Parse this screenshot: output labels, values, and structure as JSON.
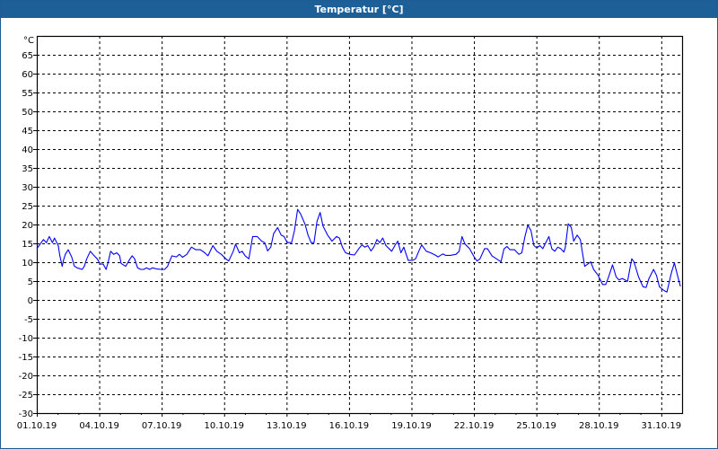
{
  "window": {
    "title": "Temperatur [°C]"
  },
  "chart_data": {
    "type": "line",
    "title": "Temperatur [°C]",
    "ylabel": "°C",
    "xlabel": "",
    "ylim": [
      -30,
      70
    ],
    "yticks": [
      65,
      60,
      55,
      50,
      45,
      40,
      35,
      30,
      25,
      20,
      15,
      10,
      5,
      0,
      -5,
      -10,
      -15,
      -20,
      -25,
      -30
    ],
    "xlim_days": [
      0,
      31
    ],
    "xtick_labels": [
      "01.10.19",
      "04.10.19",
      "07.10.19",
      "10.10.19",
      "13.10.19",
      "16.10.19",
      "19.10.19",
      "22.10.19",
      "25.10.19",
      "28.10.19",
      "31.10.19"
    ],
    "xtick_days": [
      0,
      3,
      6,
      9,
      12,
      15,
      18,
      21,
      24,
      27,
      30
    ],
    "grid": true,
    "series": [
      {
        "name": "Temperatur",
        "color": "#0000ff",
        "x_days": [
          0,
          0.32,
          0.46,
          0.6,
          0.75,
          0.85,
          0.96,
          1.03,
          1.11,
          1.22,
          1.28,
          1.37,
          1.51,
          1.68,
          1.8,
          1.94,
          2.18,
          2.28,
          2.4,
          2.57,
          2.76,
          2.9,
          3.05,
          3.19,
          3.33,
          3.43,
          3.55,
          3.69,
          3.84,
          3.98,
          4.05,
          4.27,
          4.48,
          4.58,
          4.7,
          4.84,
          4.99,
          5.13,
          5.27,
          5.42,
          5.56,
          5.78,
          5.99,
          6.14,
          6.28,
          6.49,
          6.71,
          6.85,
          7.0,
          7.21,
          7.43,
          7.64,
          7.86,
          8.07,
          8.22,
          8.46,
          8.65,
          8.86,
          9.08,
          9.22,
          9.44,
          9.55,
          9.73,
          9.87,
          10.01,
          10.19,
          10.37,
          10.59,
          10.8,
          10.95,
          11.09,
          11.24,
          11.38,
          11.57,
          11.74,
          11.88,
          12.03,
          12.24,
          12.38,
          12.53,
          12.67,
          12.89,
          13.03,
          13.18,
          13.32,
          13.46,
          13.61,
          13.75,
          13.97,
          14.18,
          14.4,
          14.54,
          14.68,
          14.83,
          15.04,
          15.26,
          15.47,
          15.62,
          15.76,
          15.9,
          16.05,
          16.19,
          16.34,
          16.48,
          16.62,
          16.77,
          17.05,
          17.2,
          17.34,
          17.49,
          17.63,
          17.84,
          18.06,
          18.2,
          18.35,
          18.49,
          18.71,
          18.92,
          19.14,
          19.28,
          19.5,
          19.64,
          19.86,
          20.14,
          20.29,
          20.43,
          20.57,
          20.79,
          21.01,
          21.15,
          21.29,
          21.51,
          21.65,
          21.87,
          22.08,
          22.3,
          22.44,
          22.59,
          22.73,
          22.95,
          23.16,
          23.3,
          23.45,
          23.59,
          23.74,
          23.88,
          24.02,
          24.17,
          24.31,
          24.45,
          24.6,
          24.74,
          24.88,
          25.03,
          25.17,
          25.32,
          25.39,
          25.53,
          25.68,
          25.79,
          25.96,
          26.11,
          26.25,
          26.32,
          26.61,
          26.75,
          26.97,
          27.18,
          27.33,
          27.47,
          27.66,
          27.83,
          27.97,
          28.12,
          28.26,
          28.38,
          28.58,
          28.69,
          28.91,
          29.12,
          29.27,
          29.41,
          29.63,
          29.77,
          29.91,
          30.13,
          30.27,
          30.49,
          30.63,
          30.78,
          30.92
        ],
        "values": [
          13.6,
          16.0,
          15.2,
          16.8,
          15.2,
          16.4,
          15.2,
          14.4,
          11.7,
          8.9,
          10.5,
          12.1,
          13.3,
          11.3,
          9.0,
          8.5,
          8.1,
          8.9,
          10.9,
          12.9,
          11.7,
          10.9,
          9.5,
          9.5,
          8.1,
          10.1,
          12.9,
          12.1,
          12.5,
          11.7,
          9.7,
          8.9,
          10.9,
          11.7,
          10.9,
          8.5,
          8.1,
          8.1,
          8.5,
          8.1,
          8.5,
          8.2,
          8.1,
          8.1,
          8.9,
          11.7,
          11.4,
          12.1,
          11.3,
          12.1,
          14.0,
          13.3,
          13.3,
          12.5,
          11.7,
          14.4,
          12.9,
          12.1,
          10.9,
          10.3,
          12.9,
          14.8,
          12.5,
          12.9,
          11.7,
          10.9,
          16.8,
          16.8,
          15.6,
          15.2,
          13.0,
          14.0,
          17.6,
          19.2,
          17.2,
          16.8,
          15.2,
          15.2,
          18.4,
          24.0,
          22.8,
          20.0,
          17.2,
          15.2,
          15.2,
          20.8,
          23.2,
          19.6,
          17.2,
          15.6,
          16.8,
          16.4,
          14.0,
          12.5,
          12.1,
          11.9,
          13.6,
          14.6,
          14.0,
          14.4,
          13.0,
          14.0,
          16.0,
          15.2,
          16.4,
          14.4,
          12.9,
          14.4,
          15.6,
          12.5,
          14.0,
          10.5,
          10.5,
          10.9,
          12.9,
          14.6,
          12.9,
          12.5,
          11.9,
          11.4,
          12.2,
          11.8,
          11.8,
          12.1,
          12.9,
          16.8,
          14.8,
          13.6,
          11.4,
          10.3,
          10.9,
          13.6,
          13.6,
          11.7,
          10.9,
          10.1,
          13.5,
          14.2,
          13.3,
          13.3,
          12.1,
          12.5,
          16.8,
          19.8,
          18.4,
          14.4,
          13.8,
          14.4,
          13.6,
          15.2,
          16.8,
          13.6,
          12.9,
          14.0,
          13.6,
          12.7,
          14.0,
          20.2,
          19.2,
          15.6,
          17.2,
          16.0,
          11.3,
          8.9,
          10.1,
          8.1,
          6.5,
          4.1,
          4.1,
          6.1,
          9.3,
          6.1,
          5.3,
          5.7,
          5.3,
          4.9,
          10.9,
          10.1,
          6.1,
          3.5,
          3.3,
          5.7,
          8.1,
          6.5,
          3.5,
          2.5,
          2.1,
          7.3,
          9.8,
          6.5,
          3.6
        ]
      }
    ]
  }
}
